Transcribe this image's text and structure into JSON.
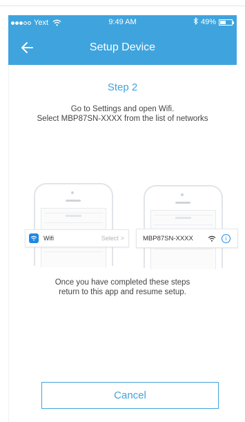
{
  "status_bar": {
    "carrier": "Yext",
    "time": "9:49 AM",
    "battery": "49%",
    "battery_level": 0.49,
    "signal_dots_filled": 3,
    "signal_dots_total": 5
  },
  "nav": {
    "title": "Setup Device",
    "back_icon": "arrow-left-icon"
  },
  "step": {
    "title": "Step 2",
    "instruction_line1": "Go to Settings and open Wifi.",
    "instruction_line2": "Select MBP87SN-XXXX from the list of networks"
  },
  "illustration": {
    "left_card": {
      "label": "Wifi",
      "action": "Select",
      "chevron": ">"
    },
    "right_card": {
      "network": "MBP87SN-XXXX",
      "info": "i"
    }
  },
  "footer_text": {
    "line1": "Once you have completed these steps",
    "line2": "return to this app and resume setup."
  },
  "buttons": {
    "cancel": "Cancel"
  },
  "colors": {
    "accent": "#3fa4dd",
    "wifi_icon": "#1e88e5",
    "text": "#444444"
  }
}
